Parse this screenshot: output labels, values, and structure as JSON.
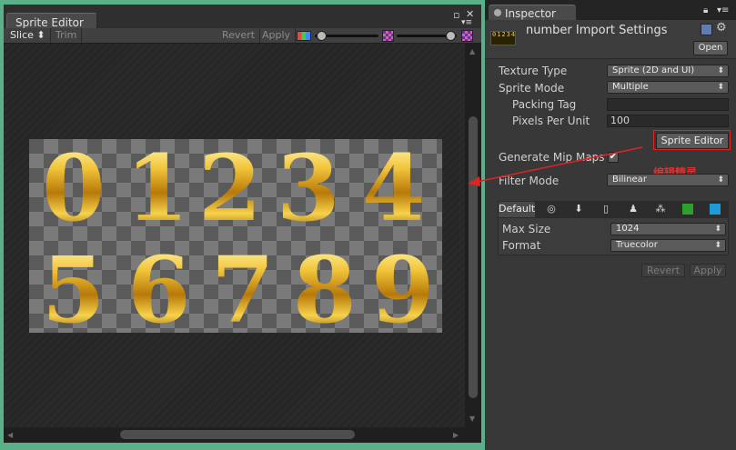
{
  "sprite_editor": {
    "tab_title": "Sprite Editor",
    "toolbar": {
      "slice_label": "Slice ⬍",
      "trim_label": "Trim",
      "revert_label": "Revert",
      "apply_label": "Apply"
    },
    "digits": [
      "0",
      "1",
      "2",
      "3",
      "4",
      "5",
      "6",
      "7",
      "8",
      "9"
    ]
  },
  "inspector": {
    "tab_title": "Inspector",
    "title": "number Import Settings",
    "asset_icon_text": "0123456789",
    "open_label": "Open",
    "properties": [
      {
        "label": "Texture Type",
        "value": "Sprite (2D and UI)",
        "kind": "dropdown"
      },
      {
        "label": "Sprite Mode",
        "value": "Multiple",
        "kind": "dropdown"
      },
      {
        "label": "Packing Tag",
        "value": "",
        "kind": "text"
      },
      {
        "label": "Pixels Per Unit",
        "value": "100",
        "kind": "text"
      }
    ],
    "sprite_editor_button": "Sprite Editor",
    "generate_mip_maps_label": "Generate Mip Maps",
    "generate_mip_maps_checked": true,
    "filter_mode": {
      "label": "Filter Mode",
      "value": "Bilinear"
    },
    "annotation_text": "编辑精灵",
    "platform_tabs": {
      "default_label": "Default"
    },
    "max_size": {
      "label": "Max Size",
      "value": "1024"
    },
    "format": {
      "label": "Format",
      "value": "Truecolor"
    },
    "revert_label": "Revert",
    "apply_label": "Apply"
  },
  "colors": {
    "window_border": "#5ab189",
    "annotation_red": "#e02424",
    "panel_bg": "#383838"
  }
}
